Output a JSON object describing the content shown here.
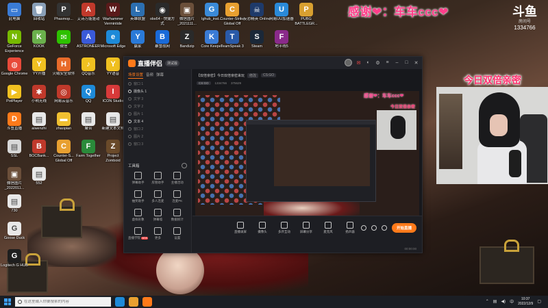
{
  "stream_overlay": {
    "thanks_text": "感谢❤：车车ccc❤",
    "logo_mark": "斗鱼",
    "logo_sub": "房间号",
    "room_number": "1334766",
    "double_banner": "今日双倍亲密"
  },
  "desktop_icons": [
    {
      "label": "此电脑",
      "color": "#3a7bd5",
      "glyph": "▭"
    },
    {
      "label": "回收站",
      "color": "#8aa0b8",
      "glyph": "🗑"
    },
    {
      "label": "Phasmop...",
      "color": "#333333",
      "glyph": "P"
    },
    {
      "label": "艾诗万能驱动",
      "color": "#c0392b",
      "glyph": "A"
    },
    {
      "label": "Warhammer Vermintide",
      "color": "#5a1a1a",
      "glyph": "W"
    },
    {
      "label": "英雄联盟",
      "color": "#2c6fb0",
      "glyph": "L"
    },
    {
      "label": "obs64 - 快捷方式",
      "color": "#2a2a2a",
      "glyph": "◉"
    },
    {
      "label": "微信图片_2021111...",
      "color": "#6b4f3a",
      "glyph": "▣"
    },
    {
      "label": "lghub_inst...",
      "color": "#3a8ad8",
      "glyph": "G"
    },
    {
      "label": "Counter-Strike Global Off",
      "color": "#e8a030",
      "glyph": "C"
    },
    {
      "label": "反恐精英 Online",
      "color": "#1e3a6a",
      "glyph": "☠"
    },
    {
      "label": "网易UU加速器",
      "color": "#2a8ad8",
      "glyph": "U"
    },
    {
      "label": "PUBG BATTLEGR...",
      "color": "#d8a030",
      "glyph": "P"
    },
    {
      "label": "GeForce Experience",
      "color": "#76b900",
      "glyph": "N"
    },
    {
      "label": "KOOK",
      "color": "#6ab04c",
      "glyph": "K"
    },
    {
      "label": "微信",
      "color": "#2dc100",
      "glyph": "✉"
    },
    {
      "label": "ASTRONEER",
      "color": "#3a5ad8",
      "glyph": "A"
    },
    {
      "label": "Microsoft Edge",
      "color": "#1e8ad8",
      "glyph": "e"
    },
    {
      "label": "赢家",
      "color": "#2a7ad8",
      "glyph": "Y"
    },
    {
      "label": "暴雪战网",
      "color": "#1a6ad8",
      "glyph": "B"
    },
    {
      "label": "Bandizip",
      "color": "#2a2a2a",
      "glyph": "Z"
    },
    {
      "label": "Core Keeper",
      "color": "#3a7bd5",
      "glyph": "K"
    },
    {
      "label": "TeamSpeak 3",
      "color": "#2a5aa8",
      "glyph": "T"
    },
    {
      "label": "Steam",
      "color": "#1b2838",
      "glyph": "S"
    },
    {
      "label": "地平线5",
      "color": "#8a2a8a",
      "glyph": "F"
    },
    {
      "label": "Google Chrome",
      "color": "#e84a3a",
      "glyph": "◍"
    },
    {
      "label": "YY开播",
      "color": "#f0c020",
      "glyph": "Y"
    },
    {
      "label": "火绒安全软件",
      "color": "#e86a2a",
      "glyph": "H"
    },
    {
      "label": "QQ音乐",
      "color": "#f0c020",
      "glyph": "♪"
    },
    {
      "label": "YY语音",
      "color": "#f0c020",
      "glyph": "Y"
    },
    {
      "label": "PotPlayer",
      "color": "#f0c020",
      "glyph": "▶"
    },
    {
      "label": "小明无线",
      "color": "#c0392b",
      "glyph": "✱"
    },
    {
      "label": "网易云音乐",
      "color": "#c0392b",
      "glyph": "◎"
    },
    {
      "label": "QQ",
      "color": "#1e8ad8",
      "glyph": "Q"
    },
    {
      "label": "ICON Studio",
      "color": "#d83a3a",
      "glyph": "I"
    },
    {
      "label": "迅雷游戏",
      "color": "#2a7ad8",
      "glyph": "X"
    },
    {
      "label": "斗鱼直播",
      "color": "#ff7a1a",
      "glyph": "D"
    },
    {
      "label": "aiwenzhi",
      "color": "#e8e8e8",
      "glyph": "▤"
    },
    {
      "label": "zhaopian",
      "color": "#f0c030",
      "glyph": "▬"
    },
    {
      "label": "聚合",
      "color": "#e8e8e8",
      "glyph": "▤"
    },
    {
      "label": "新建文本文档",
      "color": "#e8e8e8",
      "glyph": "▤"
    },
    {
      "label": "新建文本文档",
      "color": "#e8e8e8",
      "glyph": "▤"
    },
    {
      "label": "SSL",
      "color": "#d8d8d8",
      "glyph": "▤"
    },
    {
      "label": "BOCBank...",
      "color": "#c0392b",
      "glyph": "B"
    },
    {
      "label": "Counter-S... Global Off",
      "color": "#e8a030",
      "glyph": "C"
    },
    {
      "label": "Farm Together",
      "color": "#2a8a3a",
      "glyph": "F"
    },
    {
      "label": "Project Zomboid",
      "color": "#6a4a2a",
      "glyph": "Z"
    },
    {
      "label": "Brotato",
      "color": "#8a6a2a",
      "glyph": "B"
    },
    {
      "label": "微信图片_2022011...",
      "color": "#6b4f3a",
      "glyph": "▣"
    },
    {
      "label": "552",
      "color": "#e8e8e8",
      "glyph": "▤"
    },
    {
      "label": "730",
      "color": "#e8e8e8",
      "glyph": "▤"
    },
    {
      "label": "Goose Duck",
      "color": "#e8e8e8",
      "glyph": "G"
    },
    {
      "label": "Logitech G HUB",
      "color": "#1e1e1e",
      "glyph": "G"
    }
  ],
  "app": {
    "name": "直播伴侣",
    "version_badge": "测试版",
    "side_tabs": [
      "场景设置",
      "音频",
      "弹幕"
    ],
    "layers": [
      {
        "label": "窗口 1",
        "on": false
      },
      {
        "label": "摄像头 1",
        "on": true
      },
      {
        "label": "文字 3",
        "on": false
      },
      {
        "label": "文字 2",
        "on": false
      },
      {
        "label": "图片 1",
        "on": false
      },
      {
        "label": "文本 4",
        "on": true
      },
      {
        "label": "窗口 2",
        "on": false
      },
      {
        "label": "图片 2",
        "on": false
      },
      {
        "label": "窗口 3",
        "on": false
      }
    ],
    "tools_heading": "工具箱",
    "tools": [
      {
        "label": "弹幕助手",
        "badge": ""
      },
      {
        "label": "房管助手",
        "badge": ""
      },
      {
        "label": "主播活动",
        "badge": ""
      },
      {
        "label": "抽奖助手",
        "badge": ""
      },
      {
        "label": "多人连麦",
        "badge": ""
      },
      {
        "label": "连麦PK",
        "badge": ""
      },
      {
        "label": "虚拟形象",
        "badge": ""
      },
      {
        "label": "弹幕墙",
        "badge": ""
      },
      {
        "label": "数据统计",
        "badge": ""
      },
      {
        "label": "直播学院",
        "badge": "NEW"
      },
      {
        "label": "更多",
        "badge": ""
      },
      {
        "label": "设置",
        "badge": ""
      }
    ],
    "stream_title": "【双倍亲密】今日双倍亲密来玩",
    "title_tag": "修改",
    "category": "CS:GO",
    "meta_game": "CS:GO",
    "meta_items": [
      "1334766",
      "375629"
    ],
    "controls": [
      "直播录屏",
      "摄像头",
      "多开互动",
      "屏幕分享",
      "麦克风",
      "扬声器"
    ],
    "start_button": "开始直播",
    "status_left": "",
    "status_right": "00:00:00"
  },
  "taskbar": {
    "search_placeholder": "在这里输入你要搜索的内容",
    "time": "10:37",
    "date": "2022/12/9",
    "lang": "中"
  }
}
